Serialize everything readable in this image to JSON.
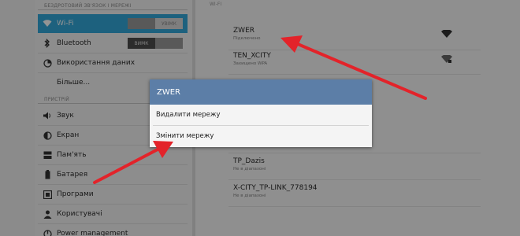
{
  "sidebar": {
    "section_wireless": "БЕЗДРОТОВИЙ ЗВ'ЯЗОК І МЕРЕЖІ",
    "section_device": "ПРИСТРІЙ",
    "items": [
      {
        "label": "Wi-Fi",
        "toggle": "УВІМК",
        "active": true
      },
      {
        "label": "Bluetooth",
        "toggle": "ВИМК"
      },
      {
        "label": "Використання даних"
      },
      {
        "label": "Більше..."
      },
      {
        "label": "Звук"
      },
      {
        "label": "Екран"
      },
      {
        "label": "Пам'ять"
      },
      {
        "label": "Батарея"
      },
      {
        "label": "Програми"
      },
      {
        "label": "Користувачі"
      },
      {
        "label": "Power management"
      }
    ]
  },
  "wifi": {
    "header": "WI-FI",
    "networks": [
      {
        "name": "ZWER",
        "status": "Підключено"
      },
      {
        "name": "TEN_XCITY",
        "status": "Захищено WPA"
      },
      {
        "name": "TP_Dazis",
        "status": "Не в діапазоні"
      },
      {
        "name": "X-CITY_TP-LINK_778194",
        "status": "Не в діапазоні"
      }
    ]
  },
  "dialog": {
    "title": "ZWER",
    "options": [
      "Видалити мережу",
      "Змінити мережу"
    ]
  },
  "colors": {
    "accent": "#33a8d9",
    "dialog_title": "#5c7ea7",
    "arrow": "#e3232a"
  }
}
